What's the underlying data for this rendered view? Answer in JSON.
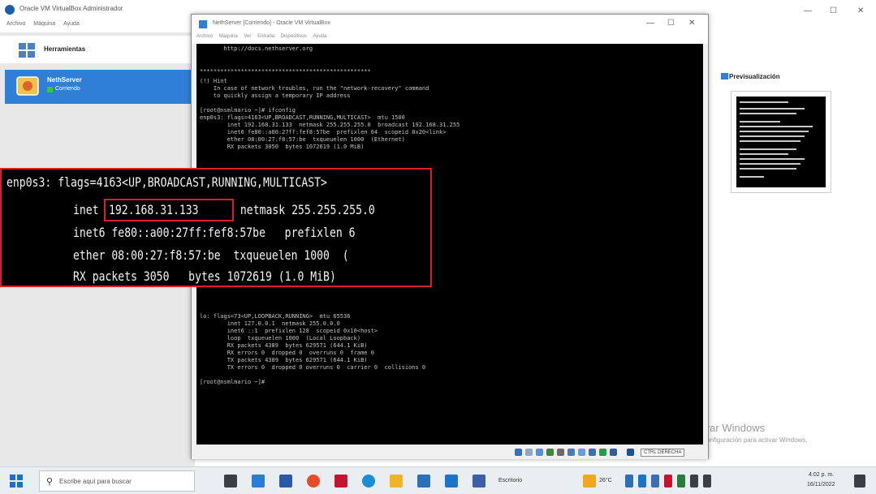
{
  "manager": {
    "title": "Oracle VM VirtualBox Administrador",
    "menu": [
      "Archivo",
      "Máquina",
      "Ayuda"
    ],
    "tools_label": "Herramientas",
    "vm_name": "NethServer",
    "vm_status": "Corriendo",
    "preview_label": "Previsualización",
    "window_controls": [
      "—",
      "☐",
      "✕"
    ]
  },
  "vm_window": {
    "title": "NethServer [Corriendo] - Oracle VM VirtualBox",
    "menu": [
      "Archivo",
      "Máquina",
      "Ver",
      "Entrada",
      "Dispositivos",
      "Ayuda"
    ],
    "window_controls": [
      "—",
      "☐",
      "✕"
    ],
    "host_key": "CTRL DERECHA"
  },
  "console": {
    "lines": [
      "       http://docs.nethserver.org",
      "",
      "",
      "**************************************************",
      "",
      "(!) Hint",
      "    In case of network troubles, run the \"network-recovery\" command",
      "    to quickly assign a temporary IP address",
      "",
      "[root@nsmlmario ~]# ifconfig",
      "enp0s3: flags=4163<UP,BROADCAST,RUNNING,MULTICAST>  mtu 1500",
      "        inet 192.168.31.133  netmask 255.255.255.0  broadcast 192.168.31.255",
      "        inet6 fe80::a00:27ff:fef8:57be  prefixlen 64  scopeid 0x20<link>",
      "        ether 08:00:27:f8:57:be  txqueuelen 1000  (Ethernet)",
      "        RX packets 3050  bytes 1072619 (1.0 MiB)"
    ],
    "lines_after": [
      "lo: flags=73<UP,LOOPBACK,RUNNING>  mtu 65536",
      "        inet 127.0.0.1  netmask 255.0.0.0",
      "        inet6 ::1  prefixlen 128  scopeid 0x10<host>",
      "        loop  txqueuelen 1000  (Local Loopback)",
      "        RX packets 4389  bytes 629571 (644.1 KiB)",
      "        RX errors 0  dropped 0  overruns 0  frame 0",
      "        TX packets 4389  bytes 629571 (644.1 KiB)",
      "        TX errors 0  dropped 0 overruns 0  carrier 0  collisions 0",
      "",
      "[root@nsmlmario ~]#"
    ],
    "zoom": {
      "line1": "enp0s3: flags=4163<UP,BROADCAST,RUNNING,MULTICAST>",
      "line2_prefix": "inet ",
      "ip": "192.168.31.133",
      "line2_suffix": " netmask 255.255.255.0",
      "line3": "inet6 fe80::a00:27ff:fef8:57be   prefixlen 6",
      "line4": "ether 08:00:27:f8:57:be  txqueuelen 1000  (",
      "line5": "RX packets 3050   bytes 1072619 (1.0 MiB)"
    }
  },
  "watermark": {
    "line1": "Activar Windows",
    "line2": "Ve a Configuración para activar Windows."
  },
  "taskbar": {
    "search_placeholder": "Escribe aquí para buscar",
    "widget_text": "Escritorio",
    "temperature": "26°C",
    "time": "4:02 p. m.",
    "date": "16/11/2022",
    "colors": {
      "start": "#1f6fd1",
      "accent_red": "#d6202c"
    }
  }
}
